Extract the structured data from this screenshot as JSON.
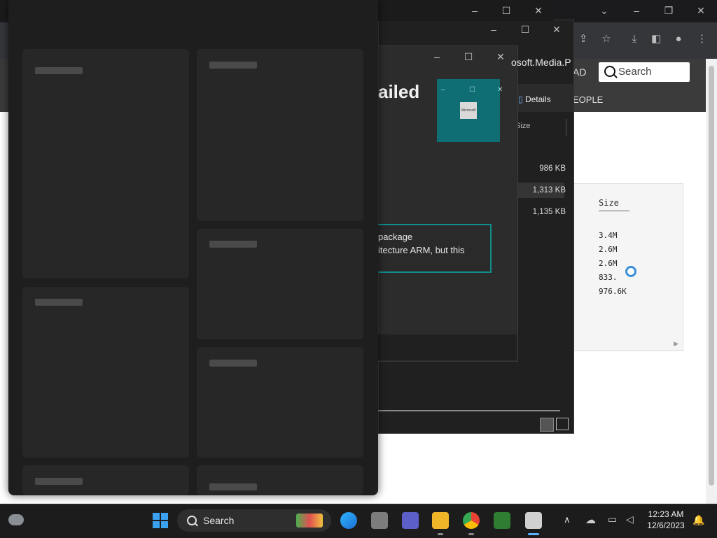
{
  "browser": {
    "search_placeholder": "Search",
    "nav_partial_1": "AD",
    "nav_partial_2": "EOPLE",
    "file_table": {
      "header": "Size",
      "rows": [
        "3.4M",
        "2.6M",
        "2.6M",
        "833.",
        "976.6K"
      ]
    }
  },
  "explorer": {
    "details_tab": "Details",
    "column_header": "Size",
    "sizes": [
      "986 KB",
      "1,313 KB",
      "1,135 KB"
    ]
  },
  "installer": {
    "title_partial": "ailed",
    "package_name_partial": "osoft.Media.P",
    "logo_text": "Microsoft",
    "error_line1": "package",
    "error_line2": "itecture ARM, but this"
  },
  "taskbar": {
    "search_label": "Search",
    "time": "12:23 AM",
    "date": "12/6/2023"
  },
  "colors": {
    "accent_teal": "#138c8c",
    "logo_bg": "#0f6e73",
    "taskbar_bg": "#1c1c1c"
  }
}
